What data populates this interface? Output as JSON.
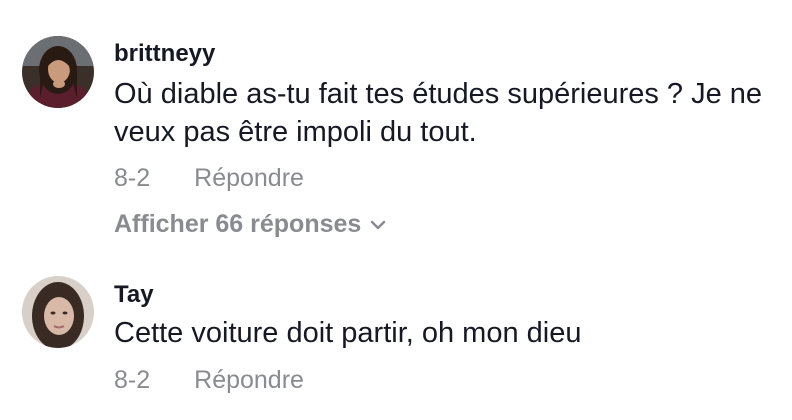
{
  "comments": [
    {
      "username": "brittneyy",
      "text": "Où diable as-tu fait tes études supérieures ? Je ne veux pas être impoli du tout.",
      "date": "8-2",
      "reply_label": "Répondre",
      "view_replies_label": "Afficher 66 réponses",
      "avatar_icon": "avatar-photo"
    },
    {
      "username": "Tay",
      "text": "Cette voiture doit partir, oh mon dieu",
      "date": "8-2",
      "reply_label": "Répondre",
      "avatar_icon": "avatar-photo"
    }
  ],
  "icons": {
    "expand": "chevron-down-icon"
  },
  "colors": {
    "username": "#161823",
    "text": "#161823",
    "secondary": "#8a8b91"
  }
}
